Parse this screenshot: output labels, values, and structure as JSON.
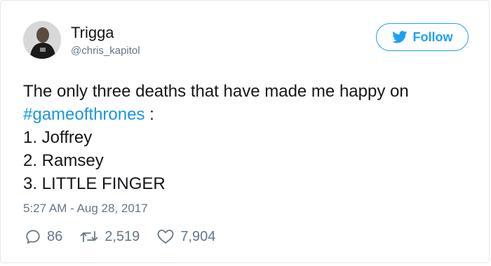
{
  "user": {
    "display_name": "Trigga",
    "handle": "@chris_kapitol"
  },
  "follow_button": {
    "label": "Follow"
  },
  "tweet": {
    "line1": "The only three deaths that have made me happy on",
    "hashtag": "#gameofthrones",
    "line2_suffix": " :",
    "line3": "1. Joffrey",
    "line4": "2. Ramsey",
    "line5": "3. LITTLE FINGER",
    "timestamp": "5:27 AM - Aug 28, 2017"
  },
  "stats": {
    "replies": "86",
    "retweets": "2,519",
    "likes": "7,904"
  },
  "colors": {
    "brand": "#1da1f2",
    "hashtag": "#1b95e0",
    "secondary_text": "#657786",
    "primary_text": "#14171a"
  },
  "icons": {
    "follow": "twitter-bird-icon",
    "reply": "reply-icon",
    "retweet": "retweet-icon",
    "like": "heart-icon"
  }
}
